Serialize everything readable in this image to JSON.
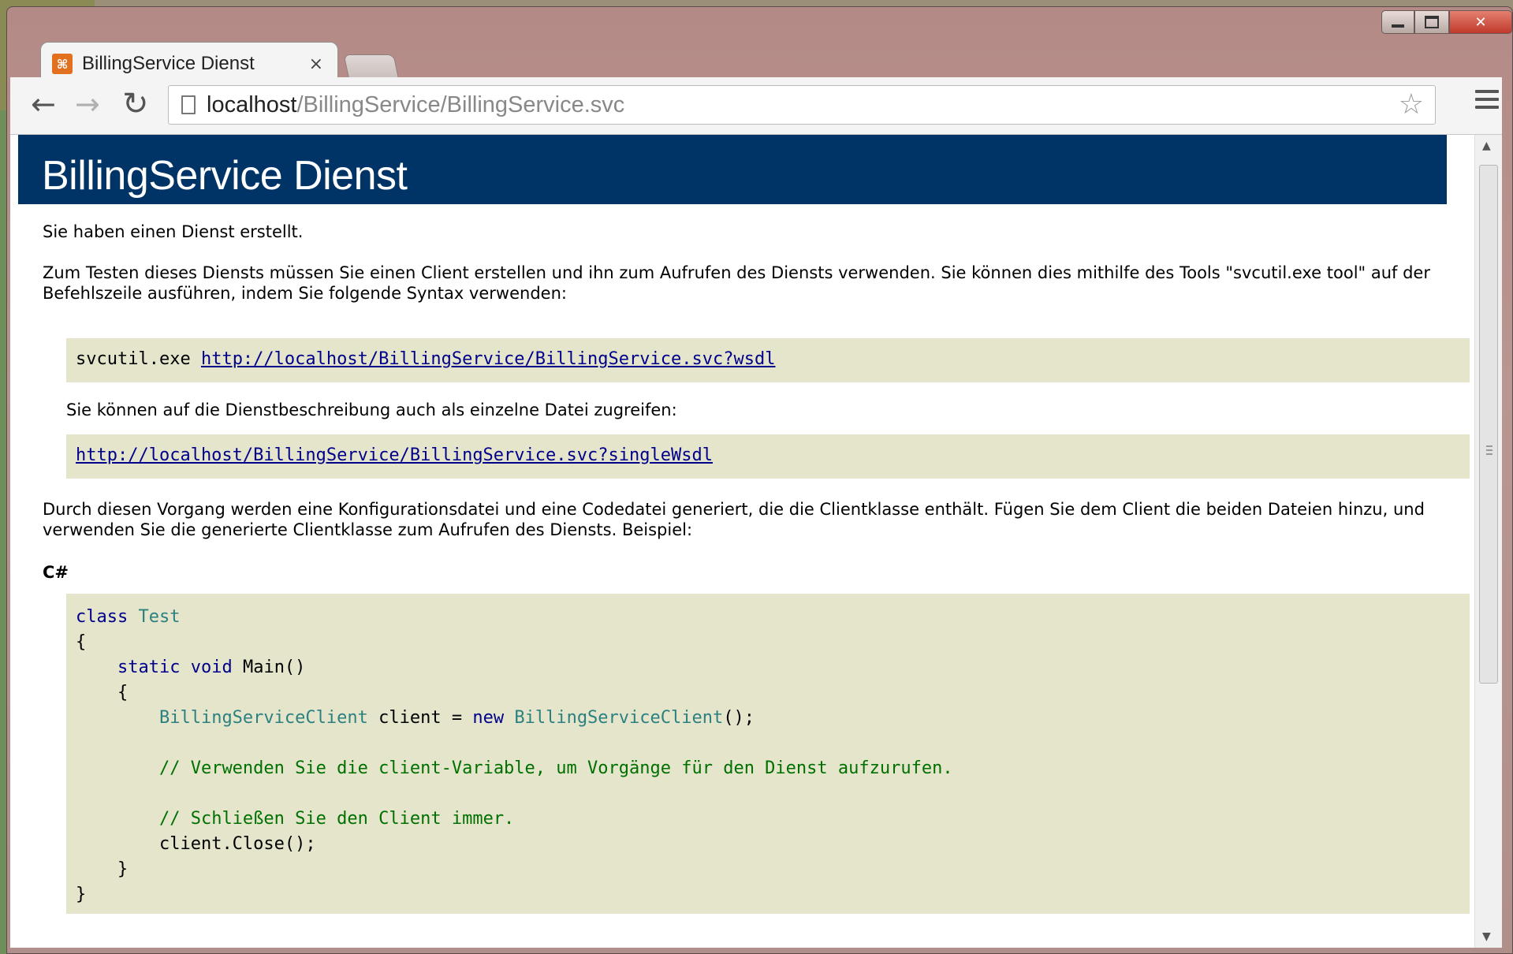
{
  "browser": {
    "tab_title": "BillingService Dienst",
    "tab_close": "×",
    "favicon_glyph": "⌘",
    "url_host": "localhost",
    "url_path": "/BillingService/BillingService.svc",
    "icons": [
      "back-arrow-icon",
      "forward-arrow-icon",
      "reload-icon",
      "page-icon",
      "star-icon",
      "menu-icon",
      "minimize-icon",
      "maximize-icon",
      "close-icon"
    ]
  },
  "page": {
    "heading": "BillingService Dienst",
    "intro": "Sie haben einen Dienst erstellt.",
    "instructions": "Zum Testen dieses Diensts müssen Sie einen Client erstellen und ihn zum Aufrufen des Diensts verwenden. Sie können dies mithilfe des Tools \"svcutil.exe tool\" auf der Befehlszeile ausführen, indem Sie folgende Syntax verwenden:",
    "svcutil_command": "svcutil.exe ",
    "wsdl_link": "http://localhost/BillingService/BillingService.svc?wsdl",
    "single_file_text": "Sie können auf die Dienstbeschreibung auch als einzelne Datei zugreifen:",
    "single_wsdl_link": "http://localhost/BillingService/BillingService.svc?singleWsdl",
    "process_text": "Durch diesen Vorgang werden eine Konfigurationsdatei und eine Codedatei generiert, die die Clientklasse enthält. Fügen Sie dem Client die beiden Dateien hinzu, und verwenden Sie die generierte Clientklasse zum Aufrufen des Diensts. Beispiel:",
    "language_label": "C#",
    "code": {
      "l1_kw": "class",
      "l1_ty": "Test",
      "l2": "{",
      "l3_kw1": "static",
      "l3_kw2": "void",
      "l3_pl": "Main()",
      "l4": "{",
      "l5_ty": "BillingServiceClient",
      "l5_pl1": "client =",
      "l5_kw": "new",
      "l5_ty2": "BillingServiceClient",
      "l5_pl2": "();",
      "l6_cm": "// Verwenden Sie die client-Variable, um Vorgänge für den Dienst aufzurufen.",
      "l7_cm": "// Schließen Sie den Client immer.",
      "l8_pl": "client.Close();",
      "l9": "}",
      "l10": "}"
    }
  },
  "colors": {
    "header_bg": "#003366",
    "code_bg": "#e5e5cc",
    "keyword": "#00008b",
    "type": "#2b8080",
    "comment": "#007000"
  }
}
